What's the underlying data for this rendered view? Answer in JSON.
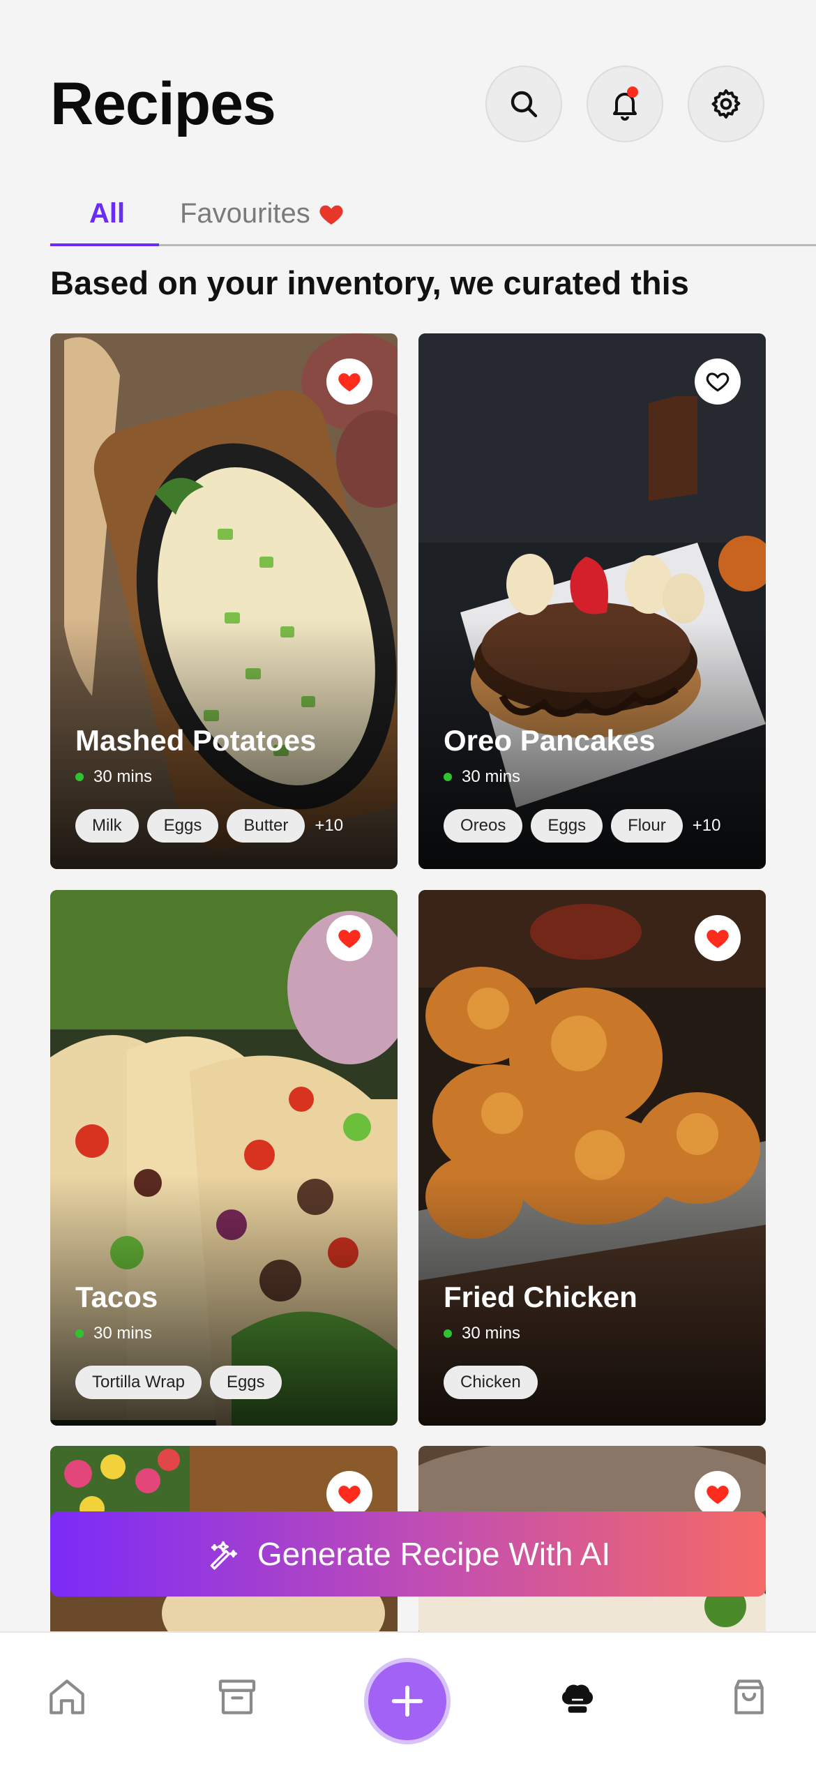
{
  "header": {
    "title": "Recipes"
  },
  "icons": {
    "search": "search-icon",
    "notifications": "bell-icon",
    "settings": "gear-icon"
  },
  "tabs": [
    {
      "label": "All",
      "active": true
    },
    {
      "label": "Favourites",
      "icon": "heart-icon"
    }
  ],
  "subtitle": "Based on your inventory, we curated this",
  "recipes": [
    {
      "name": "Mashed Potatoes",
      "time": "30 mins",
      "favourite": true,
      "ingredients": [
        "Milk",
        "Eggs",
        "Butter"
      ],
      "more": "+10"
    },
    {
      "name": "Oreo Pancakes",
      "time": "30 mins",
      "favourite": false,
      "ingredients": [
        "Oreos",
        "Eggs",
        "Flour"
      ],
      "more": "+10"
    },
    {
      "name": "Tacos",
      "time": "30 mins",
      "favourite": true,
      "ingredients": [
        "Tortilla Wrap",
        "Eggs"
      ]
    },
    {
      "name": "Fried Chicken",
      "time": "30 mins",
      "favourite": true,
      "ingredients": [
        "Chicken"
      ]
    },
    {
      "favourite": true
    },
    {
      "favourite": true
    }
  ],
  "generate_button": {
    "label": "Generate Recipe With AI",
    "icon": "magic-wand-icon"
  },
  "bottom_nav": [
    "home-icon",
    "archive-icon",
    "add-icon",
    "chef-hat-icon",
    "bag-icon"
  ],
  "colors": {
    "accent": "#6b2cf5",
    "heart": "#ff2b1c",
    "gradient_start": "#7b2bf8",
    "gradient_end": "#f46a66",
    "add_button": "#a262f6"
  }
}
